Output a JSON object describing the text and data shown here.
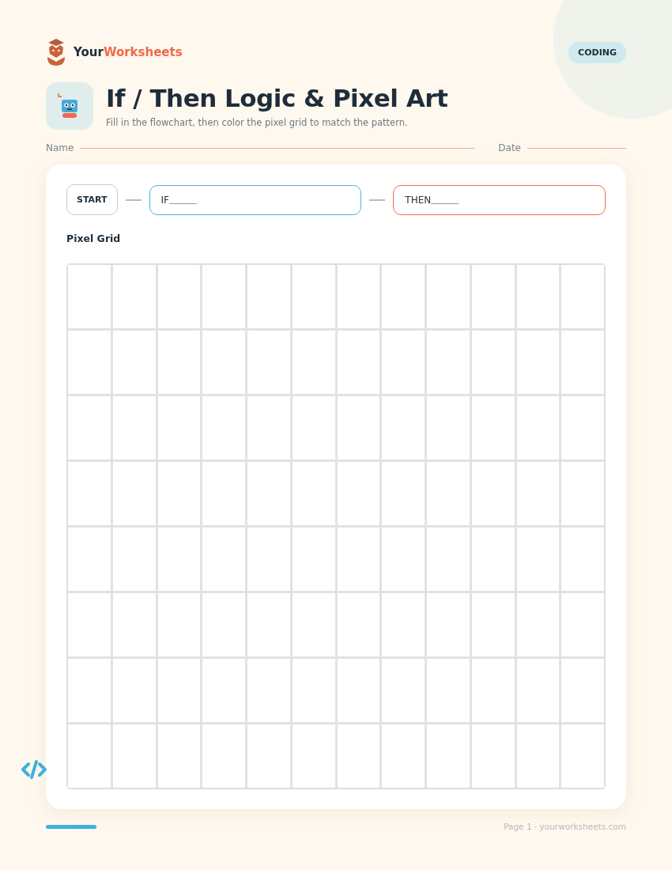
{
  "brand": {
    "name_part1": "Your",
    "name_part2": "Worksheets"
  },
  "subject_badge": "CODING",
  "title": "If / Then Logic & Pixel Art",
  "subtitle": "Fill in the flowchart, then color the pixel grid to match the pattern.",
  "name_label": "Name",
  "date_label": "Date",
  "flowchart": {
    "start": "START",
    "if_label": "IF",
    "then_label": "THEN"
  },
  "pixel_grid": {
    "title": "Pixel Grid",
    "rows": [
      {
        "cells": [
          {
            "filled": false
          },
          {
            "filled": false
          },
          {
            "filled": false
          },
          {
            "filled": false
          },
          {
            "filled": false
          },
          {
            "filled": false
          },
          {
            "filled": false
          },
          {
            "filled": false
          },
          {
            "filled": false
          },
          {
            "filled": false
          },
          {
            "filled": false
          },
          {
            "filled": false
          }
        ]
      },
      {
        "cells": [
          {
            "filled": false
          },
          {
            "filled": false
          },
          {
            "filled": false
          },
          {
            "filled": false
          },
          {
            "filled": false
          },
          {
            "filled": false
          },
          {
            "filled": false
          },
          {
            "filled": false
          },
          {
            "filled": false
          },
          {
            "filled": false
          },
          {
            "filled": false
          },
          {
            "filled": false
          }
        ]
      },
      {
        "cells": [
          {
            "filled": false
          },
          {
            "filled": false
          },
          {
            "filled": false
          },
          {
            "filled": false
          },
          {
            "filled": false
          },
          {
            "filled": false
          },
          {
            "filled": false
          },
          {
            "filled": false
          },
          {
            "filled": false
          },
          {
            "filled": false
          },
          {
            "filled": false
          },
          {
            "filled": false
          }
        ]
      },
      {
        "cells": [
          {
            "filled": false
          },
          {
            "filled": false
          },
          {
            "filled": false
          },
          {
            "filled": false
          },
          {
            "filled": false
          },
          {
            "filled": false
          },
          {
            "filled": false
          },
          {
            "filled": false
          },
          {
            "filled": false
          },
          {
            "filled": false
          },
          {
            "filled": false
          },
          {
            "filled": false
          }
        ]
      },
      {
        "cells": [
          {
            "filled": false
          },
          {
            "filled": false
          },
          {
            "filled": false
          },
          {
            "filled": false
          },
          {
            "filled": false
          },
          {
            "filled": false
          },
          {
            "filled": false
          },
          {
            "filled": false
          },
          {
            "filled": false
          },
          {
            "filled": false
          },
          {
            "filled": false
          },
          {
            "filled": false
          }
        ]
      },
      {
        "cells": [
          {
            "filled": false
          },
          {
            "filled": false
          },
          {
            "filled": false
          },
          {
            "filled": false
          },
          {
            "filled": false
          },
          {
            "filled": false
          },
          {
            "filled": false
          },
          {
            "filled": false
          },
          {
            "filled": false
          },
          {
            "filled": false
          },
          {
            "filled": false
          },
          {
            "filled": false
          }
        ]
      },
      {
        "cells": [
          {
            "filled": false
          },
          {
            "filled": false
          },
          {
            "filled": false
          },
          {
            "filled": false
          },
          {
            "filled": false
          },
          {
            "filled": false
          },
          {
            "filled": false
          },
          {
            "filled": false
          },
          {
            "filled": false
          },
          {
            "filled": false
          },
          {
            "filled": false
          },
          {
            "filled": false
          }
        ]
      },
      {
        "cells": [
          {
            "filled": false
          },
          {
            "filled": false
          },
          {
            "filled": false
          },
          {
            "filled": false
          },
          {
            "filled": false
          },
          {
            "filled": false
          },
          {
            "filled": false
          },
          {
            "filled": false
          },
          {
            "filled": false
          },
          {
            "filled": false
          },
          {
            "filled": false
          },
          {
            "filled": false
          }
        ]
      }
    ]
  },
  "footer": "Page 1 · yourworksheets.com"
}
